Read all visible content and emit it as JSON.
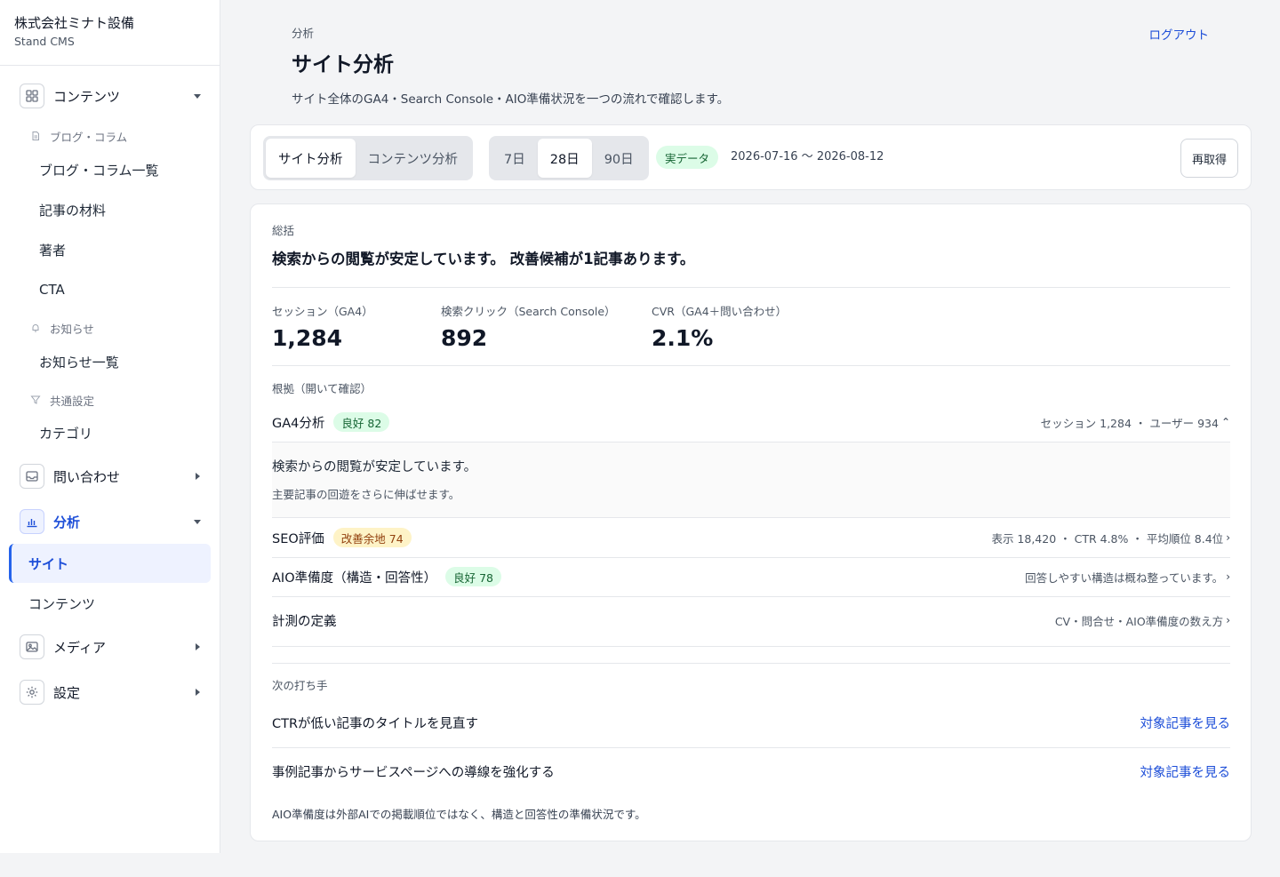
{
  "brand": {
    "company": "株式会社ミナト設備",
    "product": "Stand CMS"
  },
  "sidebar": {
    "contents": {
      "label": "コンテンツ",
      "icon": "grid-icon"
    },
    "blog_section": {
      "label": "ブログ・コラム",
      "icon": "document-icon"
    },
    "blog_items": [
      "ブログ・コラム一覧",
      "記事の材料",
      "著者",
      "CTA"
    ],
    "news_section": {
      "label": "お知らせ",
      "icon": "bell-icon"
    },
    "news_items": [
      "お知らせ一覧"
    ],
    "common_section": {
      "label": "共通設定",
      "icon": "filter-icon"
    },
    "common_items": [
      "カテゴリ"
    ],
    "inquiries": {
      "label": "問い合わせ",
      "icon": "inbox-icon"
    },
    "analytics": {
      "label": "分析",
      "icon": "bar-chart-icon"
    },
    "analytics_items": [
      "サイト",
      "コンテンツ"
    ],
    "media": {
      "label": "メディア",
      "icon": "image-icon"
    },
    "settings": {
      "label": "設定",
      "icon": "gear-icon"
    }
  },
  "header": {
    "breadcrumb": "分析",
    "title": "サイト分析",
    "description": "サイト全体のGA4・Search Console・AIO準備状況を一つの流れで確認します。",
    "logout": "ログアウト"
  },
  "toolbar": {
    "view_tabs": [
      "サイト分析",
      "コンテンツ分析"
    ],
    "active_view": "サイト分析",
    "periods": [
      "7日",
      "28日",
      "90日"
    ],
    "active_period": "28日",
    "data_badge": "実データ",
    "date_range": "2026-07-16 〜 2026-08-12",
    "refetch": "再取得"
  },
  "summary": {
    "label": "総括",
    "headline": "検索からの閲覧が安定しています。 改善候補が1記事あります。",
    "metrics": [
      {
        "label": "セッション（GA4）",
        "value": "1,284"
      },
      {
        "label": "検索クリック（Search Console）",
        "value": "892"
      },
      {
        "label": "CVR（GA4＋問い合わせ）",
        "value": "2.1%"
      }
    ]
  },
  "evidence": {
    "label": "根拠（開いて確認）",
    "ga4": {
      "title": "GA4分析",
      "badge": "良好 82",
      "meta": "セッション 1,284 ・ ユーザー 934",
      "expanded_title": "検索からの閲覧が安定しています。",
      "expanded_sub": "主要記事の回遊をさらに伸ばせます。"
    },
    "seo": {
      "title": "SEO評価",
      "badge": "改善余地 74",
      "meta": "表示 18,420 ・ CTR 4.8% ・ 平均順位 8.4位"
    },
    "aio": {
      "title": "AIO準備度（構造・回答性）",
      "badge": "良好 78",
      "meta": "回答しやすい構造は概ね整っています。"
    },
    "definition": {
      "title": "計測の定義",
      "meta": "CV・問合せ・AIO準備度の数え方"
    }
  },
  "next_actions": {
    "label": "次の打ち手",
    "items": [
      {
        "text": "CTRが低い記事のタイトルを見直す",
        "link": "対象記事を見る"
      },
      {
        "text": "事例記事からサービスページへの導線を強化する",
        "link": "対象記事を見る"
      }
    ],
    "footnote": "AIO準備度は外部AIでの掲載順位ではなく、構造と回答性の準備状況です。"
  },
  "colors": {
    "accent": "#1d4ed8",
    "good_bg": "#dcfce7",
    "good_text": "#166534",
    "warn_bg": "#fef3c7",
    "warn_text": "#92400e"
  }
}
